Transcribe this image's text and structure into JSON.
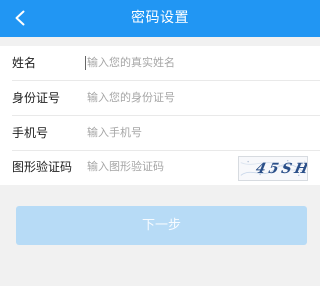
{
  "header": {
    "title": "密码设置",
    "back_icon": "chevron-left-icon",
    "background": "#2196f3"
  },
  "form": {
    "fields": [
      {
        "label": "姓名",
        "placeholder": "输入您的真实姓名",
        "value": ""
      },
      {
        "label": "身份证号",
        "placeholder": "输入您的身份证号",
        "value": ""
      },
      {
        "label": "手机号",
        "placeholder": "输入手机号",
        "value": ""
      },
      {
        "label": "图形验证码",
        "placeholder": "输入图形验证码",
        "value": ""
      }
    ],
    "captcha": {
      "text": "45SH"
    }
  },
  "actions": {
    "next_label": "下一步",
    "next_button_color": "#b7dbf6"
  }
}
